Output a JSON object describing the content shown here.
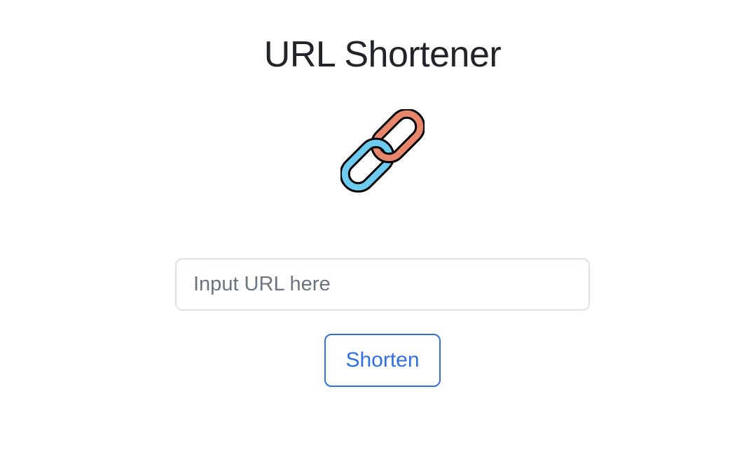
{
  "page": {
    "title": "URL Shortener"
  },
  "logo": {
    "icon": "link-icon",
    "colors": {
      "left_link": "#6ccbef",
      "right_link": "#e8866b",
      "outline": "#000000"
    }
  },
  "form": {
    "url_input": {
      "value": "",
      "placeholder": "Input URL here"
    },
    "submit_label": "Shorten"
  },
  "colors": {
    "accent": "#2f6fe0",
    "text": "#212529",
    "placeholder": "#6c757d",
    "input_border": "#dee2e6"
  }
}
